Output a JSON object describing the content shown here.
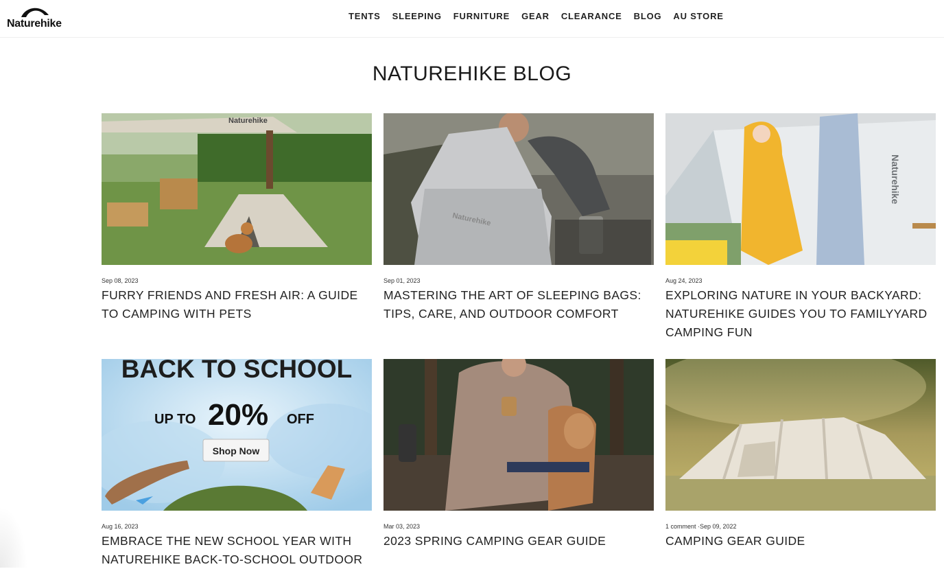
{
  "brand": {
    "name": "Naturehike"
  },
  "nav": {
    "items": [
      "TENTS",
      "SLEEPING",
      "FURNITURE",
      "GEAR",
      "CLEARANCE",
      "BLOG",
      "AU STORE"
    ]
  },
  "page": {
    "title": "NATUREHIKE BLOG"
  },
  "posts": [
    {
      "meta": "Sep 08, 2023",
      "title": "FURRY FRIENDS AND FRESH AIR: A GUIDE TO CAMPING WITH PETS",
      "image_text": "Naturehike"
    },
    {
      "meta": "Sep 01, 2023",
      "title": "MASTERING THE ART OF SLEEPING BAGS: TIPS, CARE, AND OUTDOOR COMFORT",
      "image_text": "Naturehike"
    },
    {
      "meta": "Aug 24, 2023",
      "title": "EXPLORING NATURE IN YOUR BACKYARD: NATUREHIKE GUIDES YOU TO FAMILYYARD CAMPING FUN",
      "image_text": "Naturehike"
    },
    {
      "meta": "Aug 16, 2023",
      "title": "EMBRACE THE NEW SCHOOL YEAR WITH NATUREHIKE BACK-TO-SCHOOL OUTDOOR",
      "banner": {
        "headline": "BACK TO SCHOOL",
        "up_to": "UP TO",
        "percent": "20%",
        "off": "OFF",
        "cta": "Shop Now"
      }
    },
    {
      "meta": "Mar 03, 2023",
      "title": "2023 SPRING CAMPING GEAR GUIDE"
    },
    {
      "meta": "1 comment ·Sep 09, 2022",
      "title": "CAMPING GEAR GUIDE"
    }
  ],
  "colors": {
    "accent": "#222222",
    "banner_sky": "#bfe0f5"
  }
}
